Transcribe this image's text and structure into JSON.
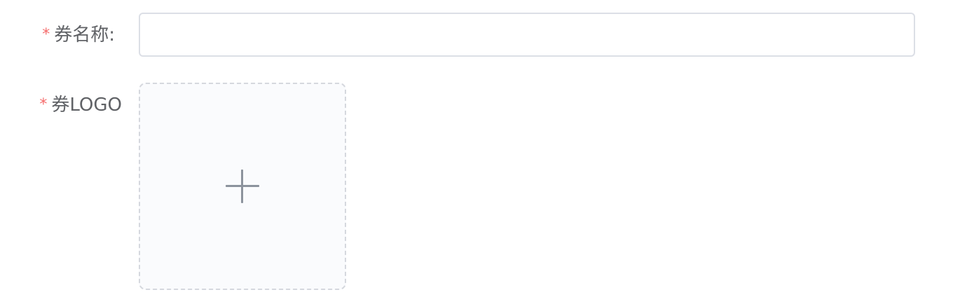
{
  "form": {
    "name_field": {
      "required_mark": "*",
      "label": "券名称:",
      "value": "",
      "placeholder": ""
    },
    "logo_field": {
      "required_mark": "*",
      "label": "券LOGO",
      "upload_icon": "plus-icon"
    }
  },
  "colors": {
    "required": "#f56c6c",
    "label": "#606266",
    "border": "#dcdfe6",
    "upload_bg": "#fafbfd",
    "icon": "#8c939d"
  }
}
